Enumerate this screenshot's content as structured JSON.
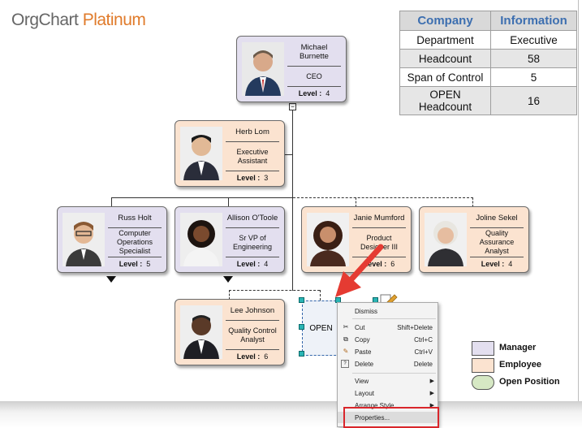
{
  "app": {
    "logo_org": "OrgChart",
    "logo_platinum": " Platinum"
  },
  "info_table": {
    "headers": [
      "Company",
      "Information"
    ],
    "rows": [
      [
        "Department",
        "Executive"
      ],
      [
        "Headcount",
        "58"
      ],
      [
        "Span of Control",
        "5"
      ],
      [
        "OPEN Headcount",
        "16"
      ]
    ]
  },
  "cards": {
    "michael": {
      "name": "Michael Burnette",
      "title": "CEO",
      "level_label": "Level :",
      "level": "4"
    },
    "herb": {
      "name": "Herb Lom",
      "title": "Executive Assistant",
      "level_label": "Level :",
      "level": "3"
    },
    "russ": {
      "name": "Russ Holt",
      "title": "Computer Operations Specialist",
      "level_label": "Level :",
      "level": "5"
    },
    "allison": {
      "name": "Allison O'Toole",
      "title": "Sr VP of Engineering",
      "level_label": "Level :",
      "level": "4"
    },
    "janie": {
      "name": "Janie Mumford",
      "title": "Product Designer III",
      "level_label": "Level :",
      "level": "6"
    },
    "joline": {
      "name": "Joline Sekel",
      "title": "Quality Assurance Analyst",
      "level_label": "Level :",
      "level": "4"
    },
    "lee": {
      "name": "Lee Johnson",
      "title": "Quality Control Analyst",
      "level_label": "Level :",
      "level": "6"
    }
  },
  "open_position": {
    "label": "OPEN"
  },
  "context_menu": {
    "dismiss": "Dismiss",
    "cut": "Cut",
    "cut_sc": "Shift+Delete",
    "copy": "Copy",
    "copy_sc": "Ctrl+C",
    "paste": "Paste",
    "paste_sc": "Ctrl+V",
    "delete": "Delete",
    "delete_sc": "Delete",
    "view": "View",
    "layout": "Layout",
    "arrange_style": "Arrange Style",
    "properties": "Properties..."
  },
  "legend": {
    "manager": "Manager",
    "employee": "Employee",
    "open_position": "Open Position"
  },
  "colors": {
    "manager_fill": "#e3dfef",
    "employee_fill": "#fbe3d0",
    "open_fill": "#d6e8c4",
    "highlight": "#d9262b",
    "arrow": "#e53b32",
    "table_header_text": "#3d6fb0"
  }
}
